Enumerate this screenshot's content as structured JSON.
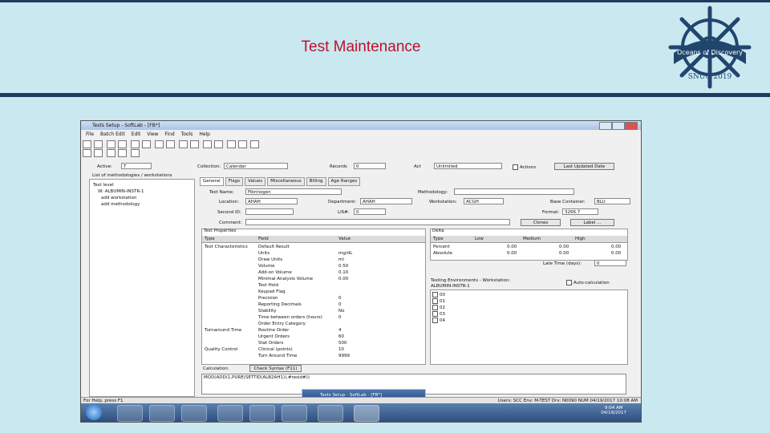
{
  "slide": {
    "title": "Test Maintenance",
    "logo": {
      "top_text": "Oceans of Discovery",
      "bottom_text": "SNUG 2019"
    }
  },
  "window": {
    "title": "Tests Setup - SoftLab - [FB*]",
    "menu": [
      "File",
      "Batch Edit",
      "Edit",
      "View",
      "Find",
      "Tools",
      "Help"
    ]
  },
  "header_fields": {
    "active_label": "Active:",
    "active_value": "T",
    "collection_label": "Collection:",
    "collection_value": "Calendar",
    "records_label": "Records",
    "records_value": "0",
    "action_label": "Act",
    "action_value": "Unlimited",
    "actions_label": "Actions",
    "last_updated_button": "Last Updated Date"
  },
  "tree": {
    "header": "List of methodologies / workstations",
    "items": [
      "Test level",
      "W: ALBUMIN-INSTR-1",
      "add workstation",
      "add methodology"
    ]
  },
  "tabs": [
    "General",
    "Flags",
    "Values",
    "Miscellaneous",
    "Billing",
    "Age Ranges"
  ],
  "general": {
    "test_name_label": "Test Name:",
    "test_name_value": "Fibrinogen",
    "methodology_label": "Methodology:",
    "location_label": "Location:",
    "location_value": "AHAH",
    "department_label": "Department:",
    "department_value": "AHAH",
    "workstation_label": "Workstation:",
    "workstation_value": "ACGH",
    "base_container_label": "Base Container:",
    "base_container_value": "BLU",
    "second_id_label": "Second ID:",
    "lis_label": "LIS#:",
    "lis_value": "0",
    "format_label": "Format:",
    "format_value": "3266.7",
    "comment_label": "Comment:",
    "clones_button": "Clones",
    "label_button": "Label ..."
  },
  "test_properties": {
    "header": "Test Properties",
    "columns": [
      "Type",
      "Field",
      "Value"
    ],
    "rows": [
      {
        "type": "Test Characteristics",
        "field": "Default Result",
        "value": ""
      },
      {
        "type": "",
        "field": "Units",
        "value": "mg/dL"
      },
      {
        "type": "",
        "field": "Draw Units",
        "value": "ml"
      },
      {
        "type": "",
        "field": "Volume",
        "value": "0.50"
      },
      {
        "type": "",
        "field": "Add-on Volume",
        "value": "0.10"
      },
      {
        "type": "",
        "field": "Minimal Analysis Volume",
        "value": "0.00"
      },
      {
        "type": "",
        "field": "Test Hold",
        "value": ""
      },
      {
        "type": "",
        "field": "Keypad Flag",
        "value": ""
      },
      {
        "type": "",
        "field": "Precision",
        "value": "0"
      },
      {
        "type": "",
        "field": "Reporting Decimals",
        "value": "0"
      },
      {
        "type": "",
        "field": "Stability",
        "value": "No"
      },
      {
        "type": "",
        "field": "Time between orders (hours)",
        "value": "0"
      },
      {
        "type": "",
        "field": "Order Entry Category",
        "value": ""
      },
      {
        "type": "Turnaround Time",
        "field": "Routine Order",
        "value": "4"
      },
      {
        "type": "",
        "field": "Urgent Orders",
        "value": "60"
      },
      {
        "type": "",
        "field": "Stat Orders",
        "value": "500"
      },
      {
        "type": "Quality Control",
        "field": "Clinical (points)",
        "value": "10"
      },
      {
        "type": "",
        "field": "Turn Around Time",
        "value": "9999"
      }
    ]
  },
  "delta": {
    "header": "Delta",
    "columns": [
      "Type",
      "Low",
      "Medium",
      "High"
    ],
    "rows": [
      {
        "type": "Percent",
        "low": "0.00",
        "medium": "0.00",
        "high": "0.00"
      },
      {
        "type": "Absolute",
        "low": "0.00",
        "medium": "0.00",
        "high": "0.00"
      }
    ],
    "late_time_label": "Late Time (days):",
    "late_time_value": "0"
  },
  "testing_environments": {
    "header": "Testing Environments - Workstation:",
    "workstation": "ALBUMIN-INSTR-1",
    "auto_calc_label": "Auto-calculation",
    "items": [
      "00",
      "01",
      "02",
      "03",
      "04"
    ]
  },
  "calculation": {
    "label": "Calculation:",
    "check_syntax_button": "Check Syntax (F11)",
    "formula": "MOD(ADD(1,PURE(SETTID(ALB2AH1)),#resid#))"
  },
  "status_bar": {
    "left": "For Help, press F1",
    "right": "Users: SCC   Env: M-TEST   Drv: N0090   NUM   04/19/2017 10:08 AM"
  },
  "popup": {
    "text": "Tests Setup - SoftLab - [FB*]"
  },
  "taskbar": {
    "time": "9:04 AM",
    "date": "04/19/2017"
  }
}
